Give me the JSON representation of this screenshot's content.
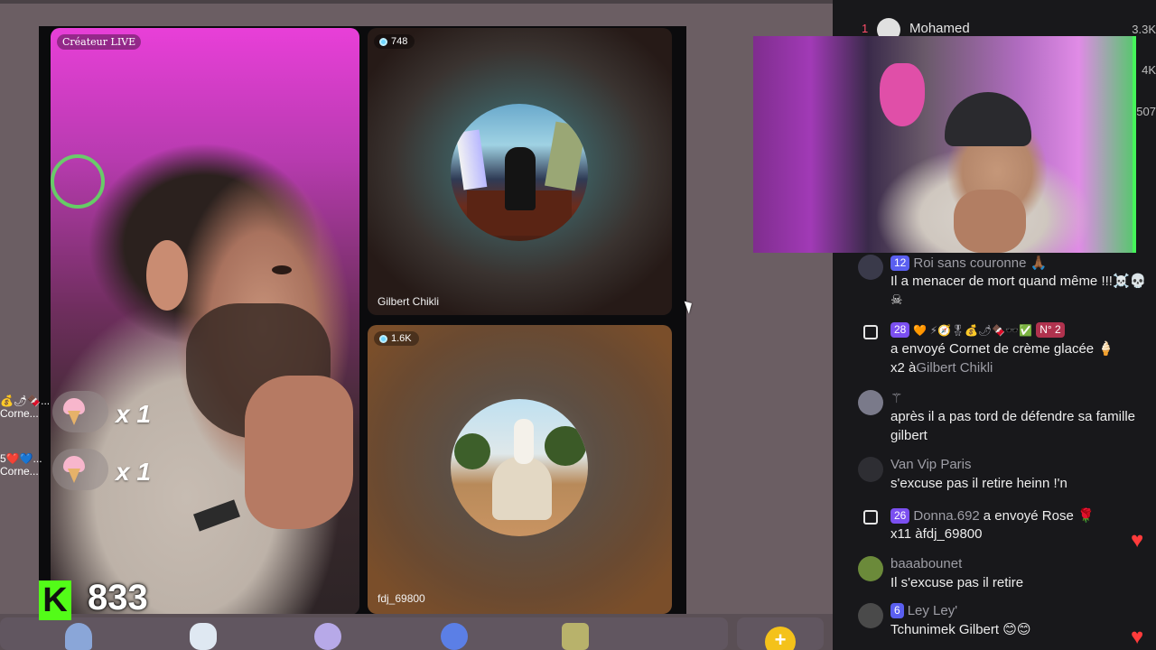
{
  "stage": {
    "host_label": "Créateur LIVE",
    "guest1": {
      "viewers": "748",
      "name": "Gilbert Chikli"
    },
    "guest2": {
      "viewers": "1.6K",
      "name": "fdj_69800"
    },
    "gift_toasts": [
      {
        "multiplier": "x 1",
        "side_prefix": "💰🌶🍫...",
        "side_text": "Corne..."
      },
      {
        "multiplier": "x 1",
        "side_prefix": "5❤️💙...",
        "side_text": "Corne..."
      }
    ]
  },
  "viewer_counter": {
    "logo": "K",
    "count": "833"
  },
  "bottom_bar": {
    "coin_icon": "+"
  },
  "chat": {
    "top_rank": {
      "rank": "1",
      "name": "Mohamed",
      "values": [
        "3.3K",
        "4K",
        "507"
      ]
    },
    "messages": [
      {
        "badge": "12",
        "username": "Roi sans couronne",
        "username_suffix": "🙏🏾",
        "text": "Il a menacer de mort quand même !!!☠️💀☠"
      },
      {
        "type": "gift",
        "badge": "28",
        "extra_badges": "🧡 ⚡🧭🎖💰🌶🍫🕶️✅",
        "rank_badge": "N° 2",
        "text_main": "a envoyé Cornet de crème glacée 🍦",
        "text_amount": "x2 à",
        "recipient": "Gilbert Chikli"
      },
      {
        "username": "⚚",
        "text": "après il a pas tord de défendre sa famille gilbert"
      },
      {
        "username": "Van Vip Paris",
        "text": "s'excuse pas il retire heinn !'n"
      },
      {
        "type": "gift",
        "badge": "26",
        "username": "Donna.692",
        "text_main": "a envoyé Rose 🌹",
        "text_amount": "x11 à",
        "recipient": "fdj_69800"
      },
      {
        "username": "baaabounet",
        "text": "Il s'excuse pas il retire"
      },
      {
        "badge": "6",
        "username": "Ley Ley'",
        "text": "Tchunimek Gilbert 😊😊"
      }
    ]
  },
  "colors": {
    "accent_green": "#53fc18",
    "chat_bg": "#18181b",
    "badge_blue": "#5a5ff0",
    "badge_purple": "#7b4ff0"
  },
  "icons": [
    "gift-icon",
    "eye-icon",
    "cursor-arrow",
    "coin-icon",
    "heart-icon"
  ]
}
